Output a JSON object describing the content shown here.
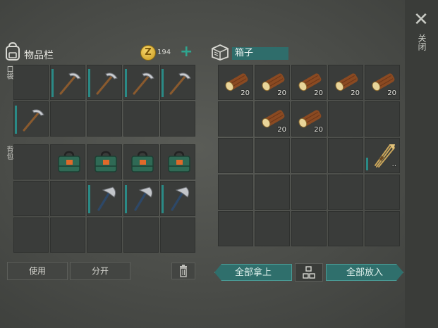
{
  "close": {
    "label": "关闭",
    "icon": "close-icon"
  },
  "inventory": {
    "title": "物品栏",
    "coins": "194",
    "section_pocket": "口袋",
    "section_backpack": "背包",
    "pocket_items": [
      "",
      "pickaxe",
      "pickaxe",
      "pickaxe",
      "pickaxe",
      "pickaxe",
      "",
      "",
      "",
      ""
    ],
    "backpack_items": [
      "",
      "toolbox",
      "toolbox",
      "toolbox",
      "toolbox",
      "",
      "",
      "hatchet",
      "hatchet",
      "hatchet",
      "",
      "",
      "",
      "",
      ""
    ],
    "use_label": "使用",
    "split_label": "分开"
  },
  "chest": {
    "title": "箱子",
    "items": [
      {
        "item": "log",
        "qty": "20"
      },
      {
        "item": "log",
        "qty": "20"
      },
      {
        "item": "log",
        "qty": "20"
      },
      {
        "item": "log",
        "qty": "20"
      },
      {
        "item": "log",
        "qty": "20"
      },
      {
        "item": "",
        "qty": ""
      },
      {
        "item": "log",
        "qty": "20"
      },
      {
        "item": "log",
        "qty": "20"
      },
      {
        "item": "",
        "qty": ""
      },
      {
        "item": "",
        "qty": ""
      },
      {
        "item": "",
        "qty": ""
      },
      {
        "item": "",
        "qty": ""
      },
      {
        "item": "",
        "qty": ""
      },
      {
        "item": "",
        "qty": ""
      },
      {
        "item": "arrow-bundle",
        "qty": "··"
      },
      {
        "item": "",
        "qty": ""
      },
      {
        "item": "",
        "qty": ""
      },
      {
        "item": "",
        "qty": ""
      },
      {
        "item": "",
        "qty": ""
      },
      {
        "item": "",
        "qty": ""
      },
      {
        "item": "",
        "qty": ""
      },
      {
        "item": "",
        "qty": ""
      },
      {
        "item": "",
        "qty": ""
      },
      {
        "item": "",
        "qty": ""
      },
      {
        "item": "",
        "qty": ""
      }
    ],
    "take_all_label": "全部拿上",
    "put_all_label": "全部放入"
  },
  "colors": {
    "accent": "#2f6f6c",
    "coin": "#e0b43a"
  }
}
